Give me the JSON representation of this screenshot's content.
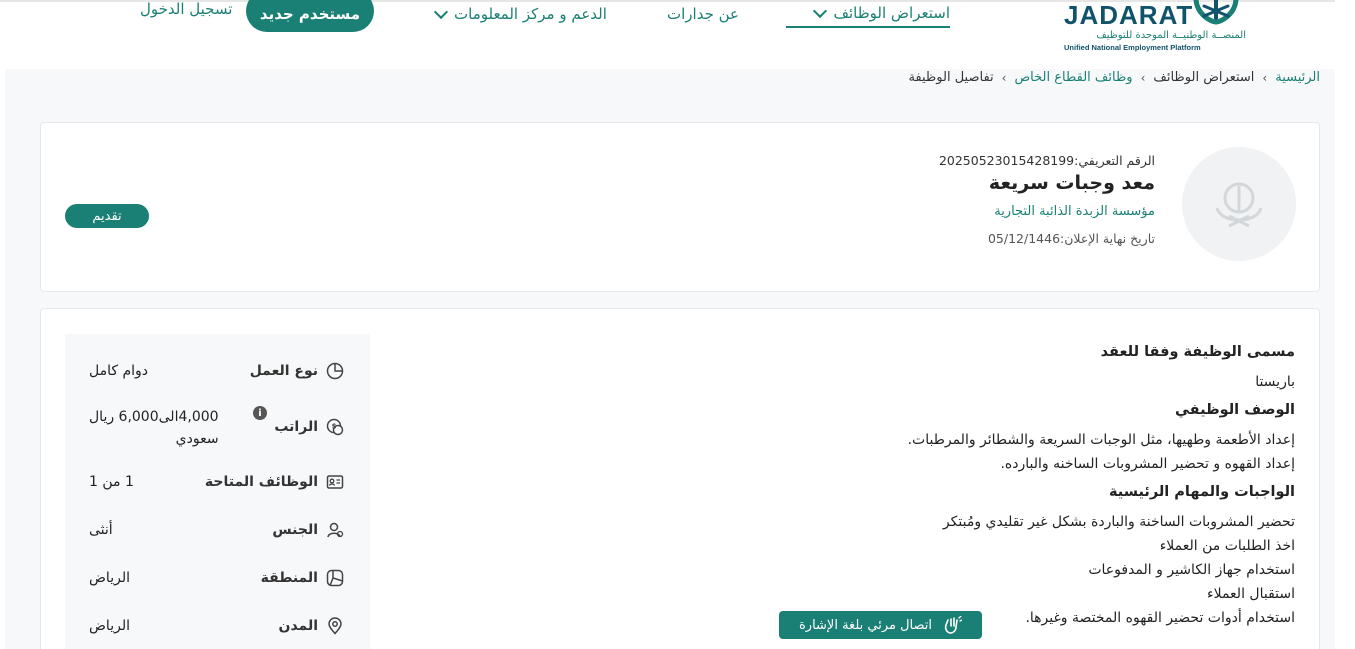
{
  "header": {
    "logo": {
      "brand": "JADARAT",
      "subtitle_ar": "المنصــة الوطنيــة الموحدة للتوظيف",
      "subtitle_en": "Unified National Employment Platform"
    },
    "nav": {
      "browse_jobs": "استعراض الوظائف",
      "about": "عن جدارات",
      "support": "الدعم و مركز المعلومات"
    },
    "new_user_label": "مستخدم جديد",
    "login_label": "تسجيل الدخول"
  },
  "breadcrumb": {
    "home": "الرئيسية",
    "browse_jobs": "استعراض الوظائف",
    "private_sector": "وظائف القطاع الخاص",
    "current": "تفاصيل الوظيفة"
  },
  "job": {
    "id_label": "الرقم التعريفي:",
    "id_value": "20250523015428199",
    "title": "معد وجبات سريعة",
    "company": "مؤسسة الزبدة الذائبة التجارية",
    "deadline_label": "تاريخ نهاية الإعلان:",
    "deadline_value": "05/12/1446",
    "apply_label": "تقديم"
  },
  "details": {
    "contract_title_heading": "مسمى الوظيفة وفقا للعقد",
    "contract_title": "باريستا",
    "description_heading": "الوصف الوظيفي",
    "description_lines": [
      "إعداد الأطعمة وطهيها، مثل الوجبات السريعة والشطائر والمرطبات.",
      "إعداد القهوه و تحضير المشروبات الساخنه والبارده."
    ],
    "duties_heading": "الواجبات والمهام الرئيسية",
    "duties_lines": [
      "تحضير المشروبات الساخنة والباردة بشكل غير تقليدي ومُبتكر",
      "اخذ الطلبات من العملاء",
      "استخدام جهاز الكاشير و المدفوعات",
      "استقبال العملاء",
      "استخدام أدوات تحضير القهوه المختصة وغيرها."
    ]
  },
  "side": {
    "work_type": {
      "label": "نوع العمل",
      "value": "دوام كامل"
    },
    "salary": {
      "label": "الراتب",
      "value_line1": "4,000الى6,000 ريال",
      "value_line2": "سعودي"
    },
    "vacancies": {
      "label": "الوظائف المتاحة",
      "value": "1 من 1"
    },
    "gender": {
      "label": "الجنس",
      "value": "أنثى"
    },
    "region": {
      "label": "المنطقة",
      "value": "الرياض"
    },
    "city": {
      "label": "المدن",
      "value": "الرياض"
    }
  },
  "sign_language_button": "اتصال مرئي بلغة الإشارة",
  "colors": {
    "primary": "#1a7f74",
    "brand_dark": "#11536b",
    "page_bg": "#f7f8fa"
  },
  "icons": [
    "chevron-down-icon",
    "clock-icon",
    "coins-icon",
    "id-card-icon",
    "user-icon",
    "map-icon",
    "location-pin-icon",
    "info-icon",
    "hand-sign-icon",
    "saudi-emblem-icon"
  ]
}
